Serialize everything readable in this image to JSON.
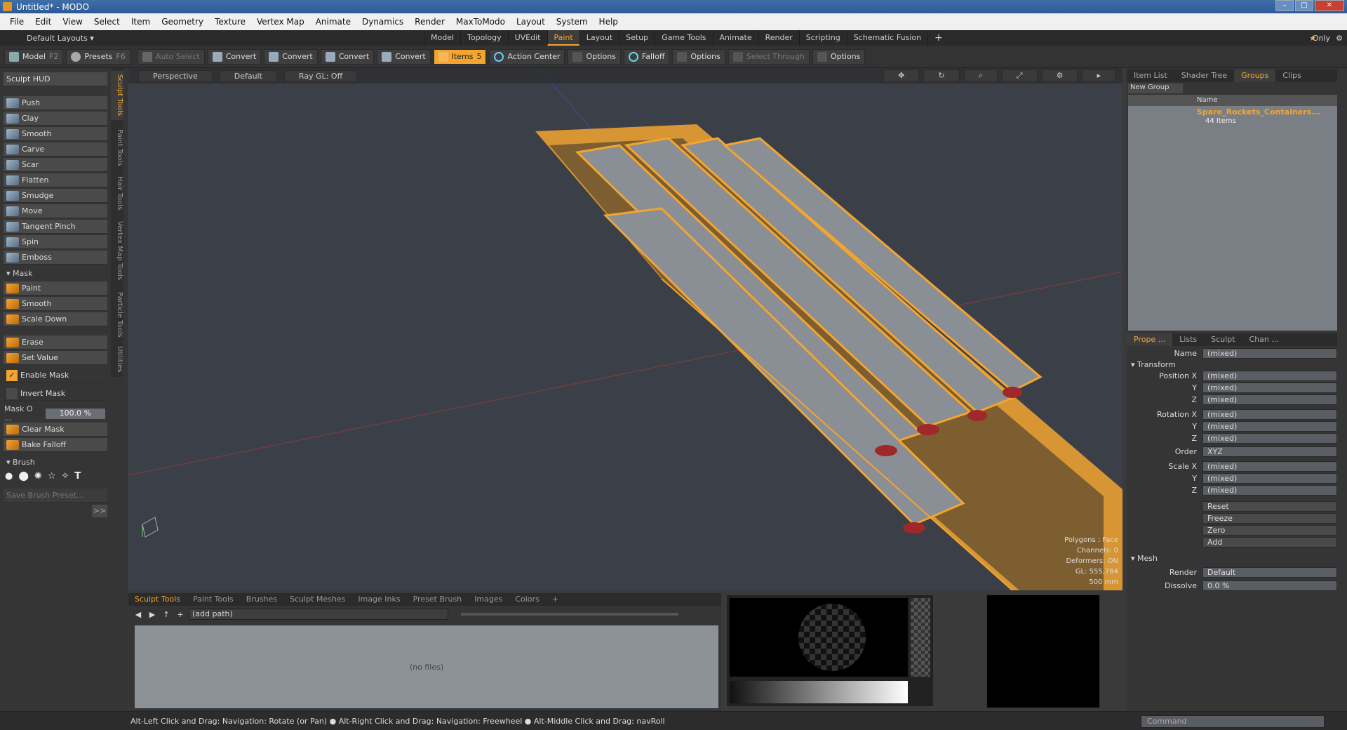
{
  "window": {
    "title": "Untitled* - MODO"
  },
  "menu": [
    "File",
    "Edit",
    "View",
    "Select",
    "Item",
    "Geometry",
    "Texture",
    "Vertex Map",
    "Animate",
    "Dynamics",
    "Render",
    "MaxToModo",
    "Layout",
    "System",
    "Help"
  ],
  "layout": {
    "default_layouts": "Default Layouts ▾",
    "tabs": [
      "Model",
      "Topology",
      "UVEdit",
      "Paint",
      "Layout",
      "Setup",
      "Game Tools",
      "Animate",
      "Render",
      "Scripting",
      "Schematic Fusion"
    ],
    "active_tab": "Paint",
    "only_label": "Only"
  },
  "toolbar": {
    "model": "Model",
    "model_key": "F2",
    "presets": "Presets",
    "presets_key": "F6",
    "auto_select": "Auto Select",
    "convert": "Convert",
    "items": "Items",
    "items_key": "5",
    "action_center": "Action Center",
    "options": "Options",
    "falloff": "Falloff",
    "select_through": "Select Through"
  },
  "left": {
    "sculpt_hud": "Sculpt HUD",
    "tools": [
      "Push",
      "Clay",
      "Smooth",
      "Carve",
      "Scar",
      "Flatten",
      "Smudge",
      "Move",
      "Tangent Pinch",
      "Spin",
      "Emboss"
    ],
    "mask_section": "Mask",
    "mask_tools": [
      "Paint",
      "Smooth",
      "Scale Down"
    ],
    "erase": "Erase",
    "set_value": "Set Value",
    "enable_mask": "Enable Mask",
    "invert_mask": "Invert Mask",
    "mask_opacity_label": "Mask O ...",
    "mask_opacity_value": "100.0 %",
    "clear_mask": "Clear Mask",
    "bake_falloff": "Bake Falloff",
    "brush_section": "Brush",
    "save_brush": "Save Brush Preset...",
    "more": ">>",
    "vtabs": [
      "Sculpt Tools",
      "Paint Tools",
      "Hair Tools",
      "Vertex Map Tools",
      "Particle Tools",
      "Utilities"
    ]
  },
  "viewport": {
    "perspective": "Perspective",
    "default": "Default",
    "raygl": "Ray GL: Off",
    "stats": [
      "Polygons : Face",
      "Channels: 0",
      "Deformers: ON",
      "GL: 555,784",
      "500 mm"
    ]
  },
  "bottom": {
    "tabs": [
      "Sculpt Tools",
      "Paint Tools",
      "Brushes",
      "Sculpt Meshes",
      "Image Inks",
      "Preset Brush",
      "Images",
      "Colors"
    ],
    "path": "(add path)",
    "no_files": "(no files)"
  },
  "right": {
    "tabs": [
      "Item List",
      "Shader Tree",
      "Groups",
      "Clips"
    ],
    "new_group": "New Group",
    "name_header": "Name",
    "group_name": "Spare_Rockets_Containers...",
    "group_count": "44 Items",
    "prop_tabs": [
      "Prope ...",
      "Lists",
      "Sculpt",
      "Chan ..."
    ],
    "name_label": "Name",
    "name_value": "(mixed)",
    "transform": "Transform",
    "rows": [
      {
        "label": "Position X",
        "value": "(mixed)"
      },
      {
        "label": "Y",
        "value": "(mixed)"
      },
      {
        "label": "Z",
        "value": "(mixed)"
      },
      {
        "label": "Rotation X",
        "value": "(mixed)"
      },
      {
        "label": "Y",
        "value": "(mixed)"
      },
      {
        "label": "Z",
        "value": "(mixed)"
      },
      {
        "label": "Order",
        "value": "XYZ"
      },
      {
        "label": "Scale X",
        "value": "(mixed)"
      },
      {
        "label": "Y",
        "value": "(mixed)"
      },
      {
        "label": "Z",
        "value": "(mixed)"
      }
    ],
    "actions": [
      "Reset",
      "Freeze",
      "Zero",
      "Add"
    ],
    "mesh": "Mesh",
    "render_label": "Render",
    "render_value": "Default",
    "dissolve_label": "Dissolve",
    "dissolve_value": "0.0 %"
  },
  "status": "Alt-Left Click and Drag: Navigation: Rotate (or Pan) ● Alt-Right Click and Drag: Navigation: Freewheel ● Alt-Middle Click and Drag: navRoll",
  "command_placeholder": "Command",
  "colors": {
    "accent": "#f3a530"
  }
}
